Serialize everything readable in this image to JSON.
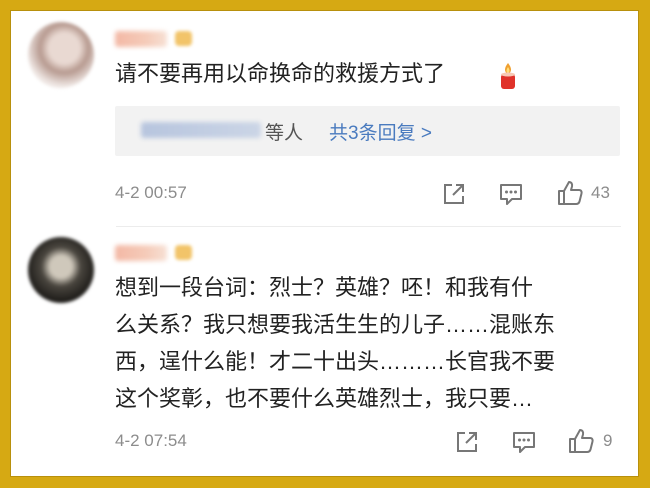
{
  "comments": [
    {
      "text": "请不要再用以命换命的救援方式了",
      "reply": {
        "suffix": "等人",
        "link": "共3条回复 >"
      },
      "time": "4-2 00:57",
      "likes": "43",
      "emoji": "candle-icon"
    },
    {
      "text": "想到一段台词：烈士？英雄？呸！和我有什\n么关系？我只想要我活生生的儿子……混账东\n西，逞什么能！才二十出头………长官我不要\n这个奖彰，也不要什么英雄烈士，我只要…",
      "time": "4-2 07:54",
      "likes": "9"
    }
  ],
  "colors": {
    "frame": "#d6a913",
    "link": "#4a7bbf",
    "meta": "#8c8c8c"
  }
}
